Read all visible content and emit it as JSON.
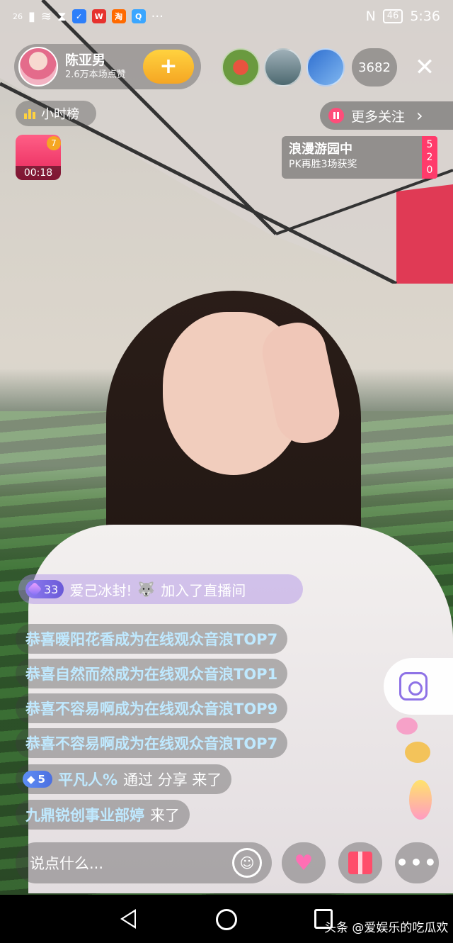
{
  "status": {
    "signal": "26",
    "time": "5:36",
    "network": "46"
  },
  "host": {
    "name": "陈亚男",
    "likes": "2.6万本场点赞",
    "follow_label": "+"
  },
  "viewers": {
    "count": "3682"
  },
  "rank": {
    "label": "小时榜"
  },
  "more_follow": {
    "label": "更多关注",
    "arrow": "›"
  },
  "gift_box": {
    "badge": "7",
    "timer": "00:18"
  },
  "pk": {
    "title": "浪漫游园中",
    "subtitle": "PK再胜3场获奖",
    "score": [
      "5",
      "2",
      "0"
    ]
  },
  "join": {
    "level": "33",
    "name": "爱己冰封!",
    "text": "加入了直播间"
  },
  "messages": [
    "恭喜暖阳花香成为在线观众音浪TOP7",
    "恭喜自然而然成为在线观众音浪TOP1",
    "恭喜不容易啊成为在线观众音浪TOP9",
    "恭喜不容易啊成为在线观众音浪TOP7"
  ],
  "share_msg": {
    "level": "5",
    "name": "平凡人%",
    "text": "通过 分享 来了"
  },
  "arrive_msg": {
    "name": "九鼎锐创事业部婷",
    "text": "来了"
  },
  "input": {
    "placeholder": "说点什么..."
  },
  "watermark": "头条 @爱娱乐的吃瓜欢",
  "colors": {
    "accent": "#ff3b6b",
    "gold": "#f5a623",
    "chat_name": "#bfe9ff",
    "camera": "#8e72e6"
  }
}
